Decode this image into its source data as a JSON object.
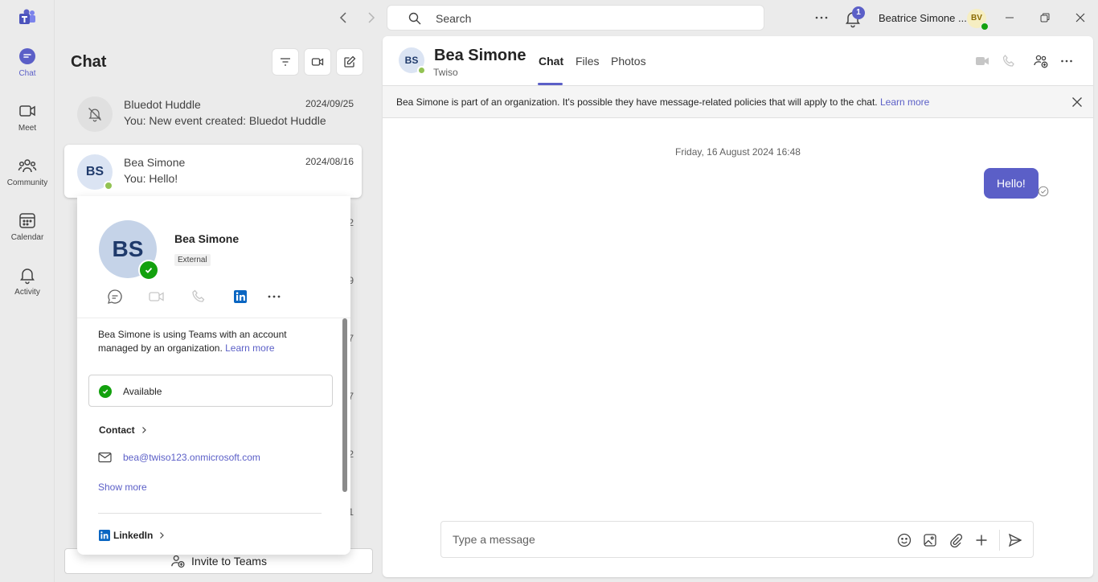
{
  "rail": {
    "items": [
      {
        "label": "Chat"
      },
      {
        "label": "Meet"
      },
      {
        "label": "Community"
      },
      {
        "label": "Calendar"
      },
      {
        "label": "Activity"
      }
    ]
  },
  "titlebar": {
    "search_placeholder": "Search",
    "notification_count": "1",
    "user_name": "Beatrice Simone ...",
    "user_initials": "BV"
  },
  "chatlist": {
    "title": "Chat",
    "items": [
      {
        "name": "Bluedot Huddle",
        "date": "2024/09/25",
        "preview": "You: New event created: Bluedot Huddle"
      },
      {
        "name": "Bea Simone",
        "initials": "BS",
        "date": "2024/08/16",
        "preview": "You: Hello!"
      }
    ],
    "fragments": [
      "2",
      "9",
      "7",
      "7",
      "2",
      "1"
    ],
    "invite_label": "Invite to Teams"
  },
  "profile_card": {
    "initials": "BS",
    "name": "Bea Simone",
    "tag": "External",
    "info_text": "Bea Simone is using Teams with an account managed by an organization.",
    "info_link": "Learn more",
    "status": "Available",
    "contact_label": "Contact",
    "email": "bea@twiso123.onmicrosoft.com",
    "show_more": "Show more",
    "linkedin_label": "LinkedIn"
  },
  "conversation": {
    "initials": "BS",
    "name": "Bea Simone",
    "org": "Twiso",
    "tabs": [
      {
        "label": "Chat"
      },
      {
        "label": "Files"
      },
      {
        "label": "Photos"
      }
    ],
    "banner_text": "Bea Simone is part of an organization. It's possible they have message-related policies that will apply to the chat.",
    "banner_link": "Learn more",
    "datestamp": "Friday, 16 August 2024 16:48",
    "message": "Hello!",
    "composer_placeholder": "Type a message"
  },
  "colors": {
    "accent": "#5b5fc7",
    "available": "#13a10e",
    "presence": "#92c353"
  }
}
